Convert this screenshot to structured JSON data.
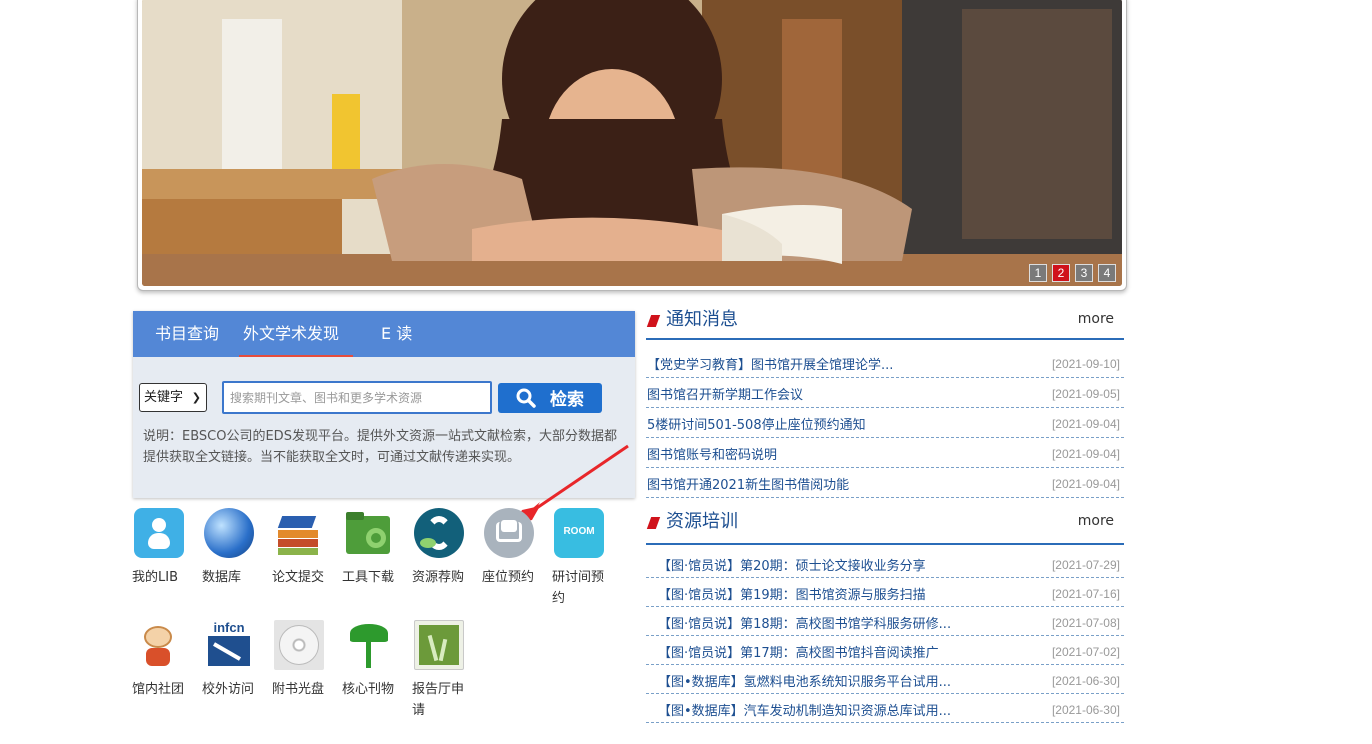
{
  "banner": {
    "pages": [
      "1",
      "2",
      "3",
      "4"
    ],
    "active_page": "2"
  },
  "search": {
    "tabs": [
      "书目查询",
      "外文学术发现",
      "E 读"
    ],
    "active_tab": "外文学术发现",
    "select_value": "关键字",
    "input_placeholder": "搜索期刊文章、图书和更多学术资源",
    "button_label": "检索",
    "description": "说明：EBSCO公司的EDS发现平台。提供外文资源一站式文献检索，大部分数据都提供获取全文链接。当不能获取全文时，可通过文献传递来实现。"
  },
  "services": [
    {
      "label": "我的LIB",
      "icon": "person-icon",
      "color": "#3fb0e6"
    },
    {
      "label": "数据库",
      "icon": "globe-icon",
      "color": "#2a6fc9"
    },
    {
      "label": "论文提交",
      "icon": "graduation-books-icon",
      "color": "#e38a2c"
    },
    {
      "label": "工具下载",
      "icon": "folder-gear-icon",
      "color": "#4e9d3a"
    },
    {
      "label": "资源荐购",
      "icon": "recommend-logo-icon",
      "color": "#12607a"
    },
    {
      "label": "座位预约",
      "icon": "seat-icon",
      "color": "#a9b3bd"
    },
    {
      "label": "研讨间预约",
      "icon": "room-icon",
      "color": "#38bde1"
    },
    {
      "label": "馆内社团",
      "icon": "mascot-icon",
      "color": "#d9502a"
    },
    {
      "label": "校外访问",
      "icon": "infcn-icon",
      "color": "#1f4f8f"
    },
    {
      "label": "附书光盘",
      "icon": "disc-icon",
      "color": "#bfbfbf"
    },
    {
      "label": "核心刊物",
      "icon": "palm-tree-icon",
      "color": "#2d9a2d"
    },
    {
      "label": "报告厅申请",
      "icon": "grass-doc-icon",
      "color": "#6c9a3a"
    }
  ],
  "notices": {
    "title": "通知消息",
    "more": "more",
    "items": [
      {
        "title": "【党史学习教育】图书馆开展全馆理论学...",
        "date": "[2021-09-10]"
      },
      {
        "title": "图书馆召开新学期工作会议",
        "date": "[2021-09-05]"
      },
      {
        "title": "5楼研讨间501-508停止座位预约通知",
        "date": "[2021-09-04]"
      },
      {
        "title": "图书馆账号和密码说明",
        "date": "[2021-09-04]"
      },
      {
        "title": "图书馆开通2021新生图书借阅功能",
        "date": "[2021-09-04]"
      }
    ]
  },
  "training": {
    "title": "资源培训",
    "more": "more",
    "items": [
      {
        "title": "【图·馆员说】第20期：硕士论文接收业务分享",
        "date": "[2021-07-29]"
      },
      {
        "title": "【图·馆员说】第19期：图书馆资源与服务扫描",
        "date": "[2021-07-16]"
      },
      {
        "title": "【图·馆员说】第18期：高校图书馆学科服务研修...",
        "date": "[2021-07-08]"
      },
      {
        "title": "【图·馆员说】第17期：高校图书馆抖音阅读推广",
        "date": "[2021-07-02]"
      },
      {
        "title": "【图•数据库】氢燃料电池系统知识服务平台试用...",
        "date": "[2021-06-30]"
      },
      {
        "title": "【图•数据库】汽车发动机制造知识资源总库试用...",
        "date": "[2021-06-30]"
      }
    ]
  }
}
